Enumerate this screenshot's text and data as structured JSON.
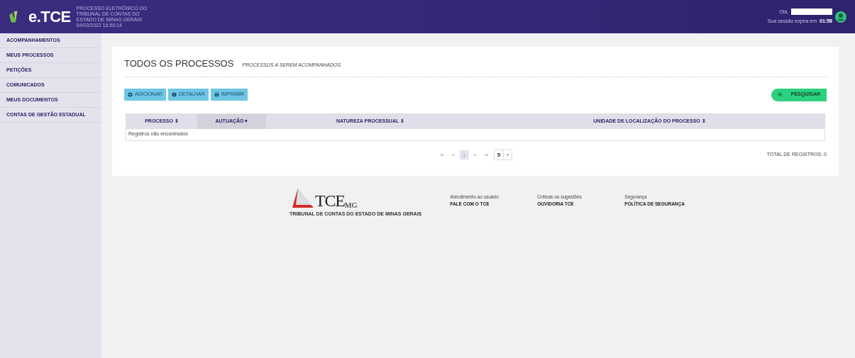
{
  "header": {
    "logo": "e.TCE",
    "subtitle_lines": [
      "PROCESSO ELETRÔNICO DO",
      "TRIBUNAL DE CONTAS DO",
      "ESTADO DE MINAS GERAIS",
      "04/03/2022 16:50:14"
    ],
    "greeting": "Olá,",
    "session_label": "Sua sessão expira em",
    "session_time": "01:58"
  },
  "sidebar": {
    "items": [
      {
        "label": "ACOMPANHAMENTOS",
        "selected": false
      },
      {
        "label": "MEUS PROCESSOS",
        "selected": false
      },
      {
        "label": "PETIÇÕES",
        "selected": false
      },
      {
        "label": "COMUNICADOS",
        "selected": false
      },
      {
        "label": "MEUS DOCUMENTOS",
        "selected": false
      },
      {
        "label": "CONTAS DE GESTÃO ESTADUAL",
        "selected": false
      }
    ]
  },
  "page": {
    "title": "TODOS OS PROCESSOS",
    "subtitle": "PROCESSOS A SEREM ACOMPANHADOS",
    "actions": [
      {
        "label": "ADICIONAR",
        "kind": "plus"
      },
      {
        "label": "DETALHAR",
        "kind": "info"
      },
      {
        "label": "IMPRIMIR",
        "kind": "print"
      }
    ],
    "search_button": "PESQUISAR",
    "table": {
      "columns": [
        {
          "label": "PROCESSO ⇕",
          "selected": false
        },
        {
          "label": "AUTUAÇÃO ▾",
          "selected": true
        },
        {
          "label": "NATUREZA PROCESSUAL ⇕",
          "selected": false
        },
        {
          "label": "UNIDADE DE LOCALIZAÇÃO DO PROCESSO ⇕",
          "selected": false
        }
      ],
      "empty_message": "Registros não encontrados"
    },
    "pagination": {
      "buttons": [
        "⇤",
        "«",
        "»",
        "⇥"
      ],
      "current_page": "1",
      "page_size": "5",
      "total": "TOTAL DE REGISTROS: 0"
    }
  },
  "footer": {
    "logo_text": "TCE",
    "logo_suffix": "MG",
    "logo_caption": "TRIBUNAL DE CONTAS DO ESTADO DE MINAS GERAIS",
    "links": [
      {
        "caption": "Atendimento ao usuário",
        "label": "FALE COM O TCE"
      },
      {
        "caption": "Críticas ou sugestões",
        "label": "OUVIDORIA TCE"
      },
      {
        "caption": "Segurança",
        "label": "POLÍTICA DE SEGURANÇA"
      }
    ]
  }
}
